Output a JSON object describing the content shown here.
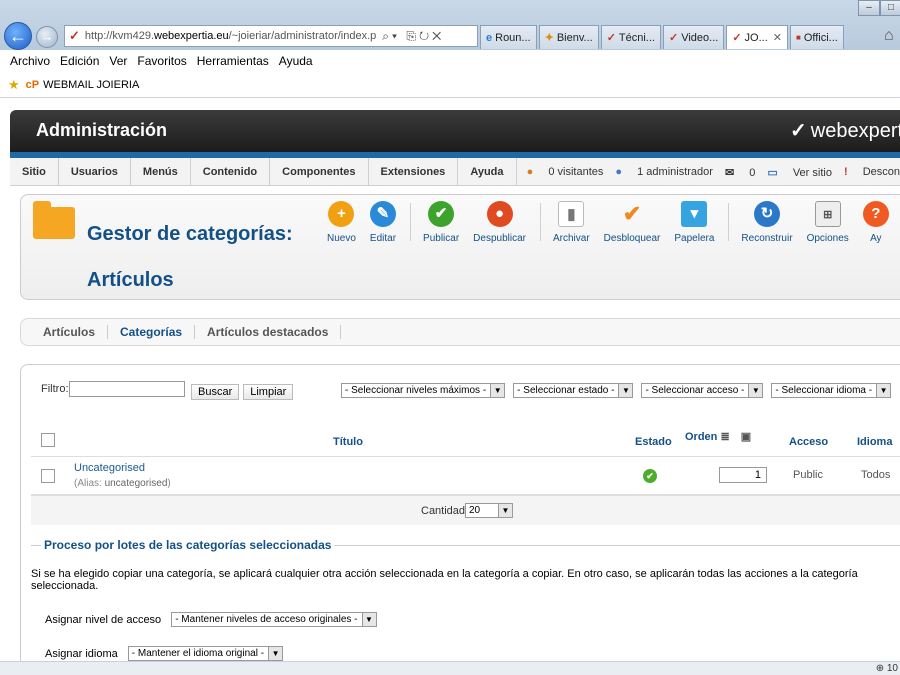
{
  "browser": {
    "url_prefix": "http://kvm429.",
    "url_host": "webexpertia.eu",
    "url_rest": "/~joieriar/administrator/index.p",
    "tabs": [
      {
        "label": "Roun...",
        "icon": "ie-icon",
        "active": false
      },
      {
        "label": "Bienv...",
        "icon": "site-icon",
        "active": false
      },
      {
        "label": "Técni...",
        "icon": "joomla-icon",
        "active": false
      },
      {
        "label": "Video...",
        "icon": "joomla-icon",
        "active": false
      },
      {
        "label": "JO...",
        "icon": "joomla-icon",
        "active": true
      },
      {
        "label": "Offici...",
        "icon": "site-icon",
        "active": false
      }
    ],
    "menu": [
      "Archivo",
      "Edición",
      "Ver",
      "Favoritos",
      "Herramientas",
      "Ayuda"
    ],
    "favorite": {
      "prefix": "cP",
      "label": "WEBMAIL JOIERIA"
    },
    "zoom": "10"
  },
  "header": {
    "title": "Administración",
    "brand": "webexpertia"
  },
  "nav": {
    "items": [
      "Sitio",
      "Usuarios",
      "Menús",
      "Contenido",
      "Componentes",
      "Extensiones",
      "Ayuda"
    ],
    "status": {
      "visitors": "0 visitantes",
      "admins": "1 administrador",
      "messages": "0",
      "view_site": "Ver sitio",
      "logout": "Descon"
    }
  },
  "toolbar": {
    "title_line1": "Gestor de categorías:",
    "title_line2": "Artículos",
    "buttons": [
      {
        "label": "Nuevo",
        "icon": "plus-icon",
        "color": "#f0a010",
        "glyph": "+"
      },
      {
        "label": "Editar",
        "icon": "pencil-icon",
        "color": "#2a8ad8",
        "glyph": "✎"
      },
      {
        "label": "Publicar",
        "icon": "check-icon",
        "color": "#3da32c",
        "glyph": "✔"
      },
      {
        "label": "Despublicar",
        "icon": "stop-icon",
        "color": "#e04a20",
        "glyph": "●"
      },
      {
        "label": "Archivar",
        "icon": "archive-icon",
        "color": "#9a9a9a",
        "glyph": "▮"
      },
      {
        "label": "Desbloquear",
        "icon": "unlock-check-icon",
        "color": "#f08a20",
        "glyph": "✔"
      },
      {
        "label": "Papelera",
        "icon": "trash-icon",
        "color": "#36a4e0",
        "glyph": "▼"
      },
      {
        "label": "Reconstruir",
        "icon": "refresh-icon",
        "color": "#2a78c8",
        "glyph": "↻"
      },
      {
        "label": "Opciones",
        "icon": "options-icon",
        "color": "#8a8a8a",
        "glyph": "⊞"
      },
      {
        "label": "Ay",
        "icon": "help-icon",
        "color": "#f05a20",
        "glyph": "?"
      }
    ]
  },
  "subtabs": [
    {
      "label": "Artículos",
      "active": false
    },
    {
      "label": "Categorías",
      "active": true
    },
    {
      "label": "Artículos destacados",
      "active": false
    }
  ],
  "filters": {
    "label": "Filtro:",
    "search_button": "Buscar",
    "clear_button": "Limpiar",
    "selects": [
      "- Seleccionar niveles máximos -",
      "- Seleccionar estado -",
      "- Seleccionar acceso -",
      "- Seleccionar idioma -"
    ]
  },
  "table": {
    "headers": {
      "title": "Título",
      "state": "Estado",
      "order": "Orden",
      "access": "Acceso",
      "language": "Idioma"
    },
    "rows": [
      {
        "title": "Uncategorised",
        "alias_label": "(Alias: ",
        "alias_value": "uncategorised",
        "alias_close": ")",
        "state": "published",
        "order": "1",
        "access": "Public",
        "language": "Todos"
      }
    ],
    "amount_label": "Cantidad",
    "amount_value": "20"
  },
  "batch": {
    "legend": "Proceso por lotes de las categorías seleccionadas",
    "text": "Si se ha elegido copiar una categoría, se aplicará cualquier otra acción seleccionada en la categoría a copiar. En otro caso, se aplicarán todas las acciones a la categoría seleccionada.",
    "access_label": "Asignar nivel de acceso",
    "access_value": "- Mantener niveles de acceso originales -",
    "lang_label": "Asignar idioma",
    "lang_value": "- Mantener el idioma original -"
  },
  "colors": {
    "accent": "#135087",
    "header_dark": "#1c1c1c",
    "strip": "#1d6aa6"
  }
}
